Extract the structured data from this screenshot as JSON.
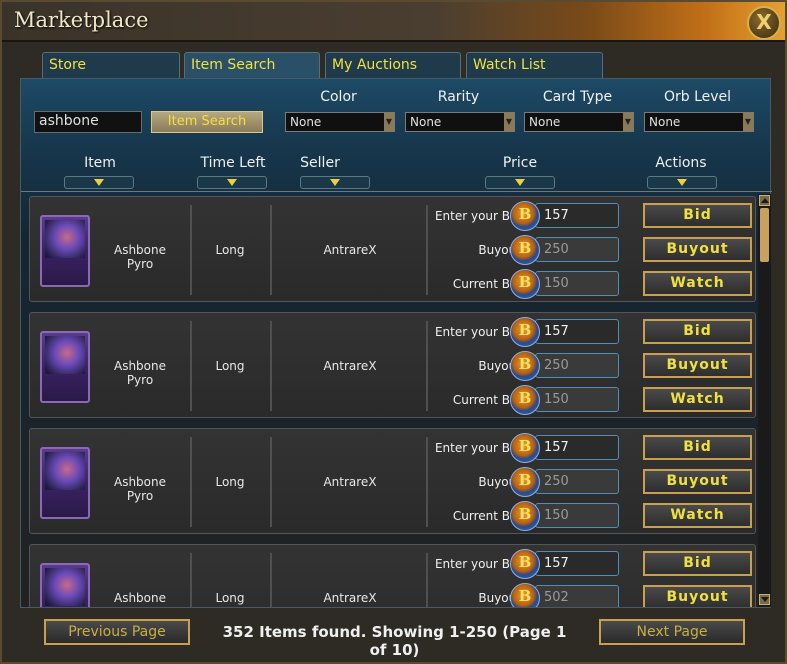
{
  "window": {
    "title": "Marketplace",
    "close_label": "X"
  },
  "tabs": [
    {
      "label": "Store",
      "active": false
    },
    {
      "label": "Item Search",
      "active": true
    },
    {
      "label": "My Auctions",
      "active": false
    },
    {
      "label": "Watch List",
      "active": false
    }
  ],
  "search": {
    "value": "ashbone",
    "button_label": "Item Search"
  },
  "filters": [
    {
      "label": "Color",
      "selected": "None"
    },
    {
      "label": "Rarity",
      "selected": "None"
    },
    {
      "label": "Card Type",
      "selected": "None"
    },
    {
      "label": "Orb Level",
      "selected": "None"
    }
  ],
  "columns": {
    "item": "Item",
    "time_left": "Time Left",
    "seller": "Seller",
    "price": "Price",
    "actions": "Actions"
  },
  "labels": {
    "enter_bid": "Enter your Bid:",
    "buyout": "Buyout:",
    "current_bid": "Current Bid:",
    "bid_button": "Bid",
    "buyout_button": "Buyout",
    "watch_button": "Watch"
  },
  "rows": [
    {
      "item_name": "Ashbone Pyro",
      "time_left": "Long",
      "seller": "AntrareX",
      "bid": "157",
      "buyout": "250",
      "current_bid": "150"
    },
    {
      "item_name": "Ashbone Pyro",
      "time_left": "Long",
      "seller": "AntrareX",
      "bid": "157",
      "buyout": "250",
      "current_bid": "150"
    },
    {
      "item_name": "Ashbone Pyro",
      "time_left": "Long",
      "seller": "AntrareX",
      "bid": "157",
      "buyout": "250",
      "current_bid": "150"
    },
    {
      "item_name": "Ashbone Pyro",
      "time_left": "Long",
      "seller": "AntrareX",
      "bid": "157",
      "buyout": "502",
      "current_bid": ""
    }
  ],
  "footer": {
    "prev_label": "Previous Page",
    "next_label": "Next Page",
    "status": "352 Items found. Showing 1-250 (Page 1 of 10)"
  },
  "icons": {
    "close": "close-icon",
    "coin": "gold-coin-icon",
    "sort": "sort-arrow-icon",
    "dropdown": "chevron-down-icon"
  }
}
